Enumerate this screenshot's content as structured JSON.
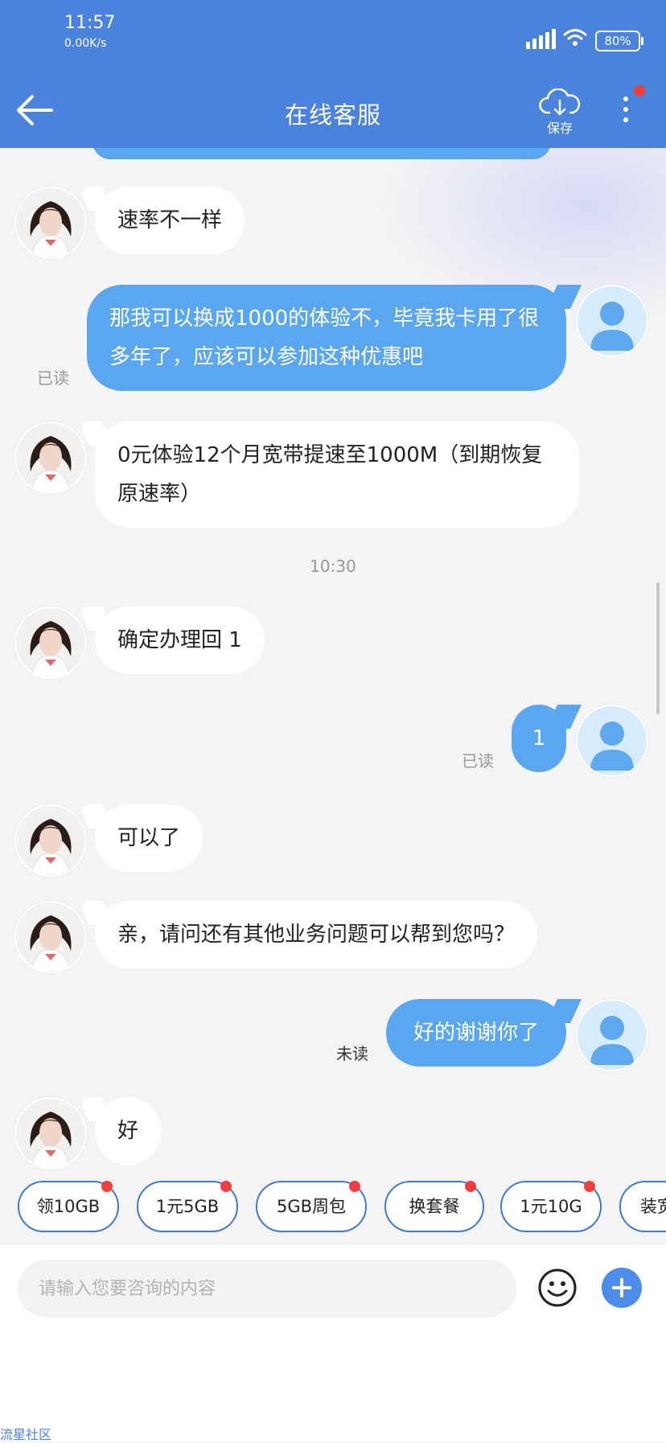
{
  "status_bar": {
    "time": "11:57",
    "net_speed": "0.00K/s",
    "battery": "80%"
  },
  "header": {
    "title": "在线客服",
    "save_label": "保存"
  },
  "messages": [
    {
      "from": "agent",
      "text": "速率不一样"
    },
    {
      "from": "user",
      "text": "那我可以换成1000的体验不，毕竟我卡用了很多年了，应该可以参加这种优惠吧",
      "status": "已读"
    },
    {
      "from": "agent",
      "text": "0元体验12个月宽带提速至1000M（到期恢复原速率）"
    },
    {
      "from": "agent",
      "text": "确定办理回 1"
    },
    {
      "from": "user",
      "text": "1",
      "status": "已读"
    },
    {
      "from": "agent",
      "text": "可以了"
    },
    {
      "from": "agent",
      "text": "亲，请问还有其他业务问题可以帮到您吗？"
    },
    {
      "from": "user",
      "text": "好的谢谢你了",
      "status": "未读"
    },
    {
      "from": "agent",
      "text": "好"
    }
  ],
  "timestamp": "10:30",
  "quick_replies": [
    "领10GB",
    "1元5GB",
    "5GB周包",
    "换套餐",
    "1元10G",
    "装宽带"
  ],
  "input": {
    "placeholder": "请输入您要咨询的内容",
    "value": ""
  },
  "watermark": "流星社区",
  "colors": {
    "header": "#4a82dc",
    "user_bubble": "#5aa7ef",
    "chip_border": "#3f78cc",
    "badge": "#f23d3d"
  },
  "icons": [
    "back-arrow-icon",
    "cloud-download-icon",
    "more-vertical-icon",
    "emoji-icon",
    "plus-icon",
    "signal-icon",
    "wifi-icon",
    "battery-icon"
  ]
}
